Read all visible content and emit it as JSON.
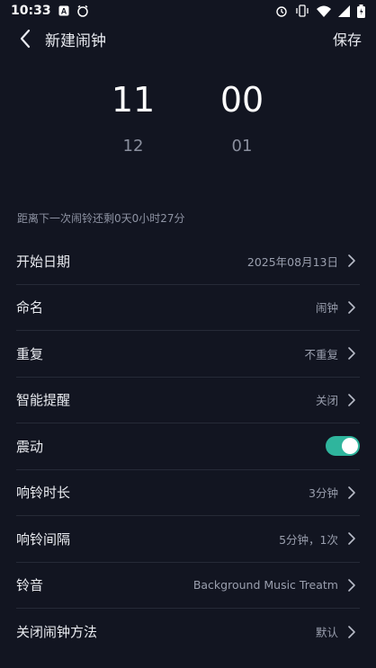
{
  "status_bar": {
    "time": "10:33",
    "left_icons": [
      "font-a-icon",
      "alarm-clock-icon"
    ],
    "right_icons": [
      "alarm-icon",
      "vibrate-icon",
      "wifi-icon",
      "signal-icon",
      "battery-icon"
    ]
  },
  "header": {
    "title": "新建闹钟",
    "save_label": "保存"
  },
  "picker": {
    "hour": "11",
    "next_hour": "12",
    "minute": "00",
    "next_minute": "01"
  },
  "countdown_text": "距离下一次闹铃还剩0天0小时27分",
  "settings": {
    "start_date": {
      "label": "开始日期",
      "value": "2025年08月13日"
    },
    "name": {
      "label": "命名",
      "value": "闹钟"
    },
    "repeat": {
      "label": "重复",
      "value": "不重复"
    },
    "smart_reminder": {
      "label": "智能提醒",
      "value": "关闭"
    },
    "vibrate": {
      "label": "震动",
      "enabled": true
    },
    "ring_duration": {
      "label": "响铃时长",
      "value": "3分钟"
    },
    "ring_interval": {
      "label": "响铃间隔",
      "value": "5分钟，1次"
    },
    "ringtone": {
      "label": "铃音",
      "value": "Background Music Treatm"
    },
    "dismiss_method": {
      "label": "关闭闹钟方法",
      "value": "默认"
    }
  },
  "colors": {
    "background": "#121521",
    "toggle_on": "#2FB59D",
    "divider": "#262A37",
    "secondary_text": "#9A9FAE"
  }
}
